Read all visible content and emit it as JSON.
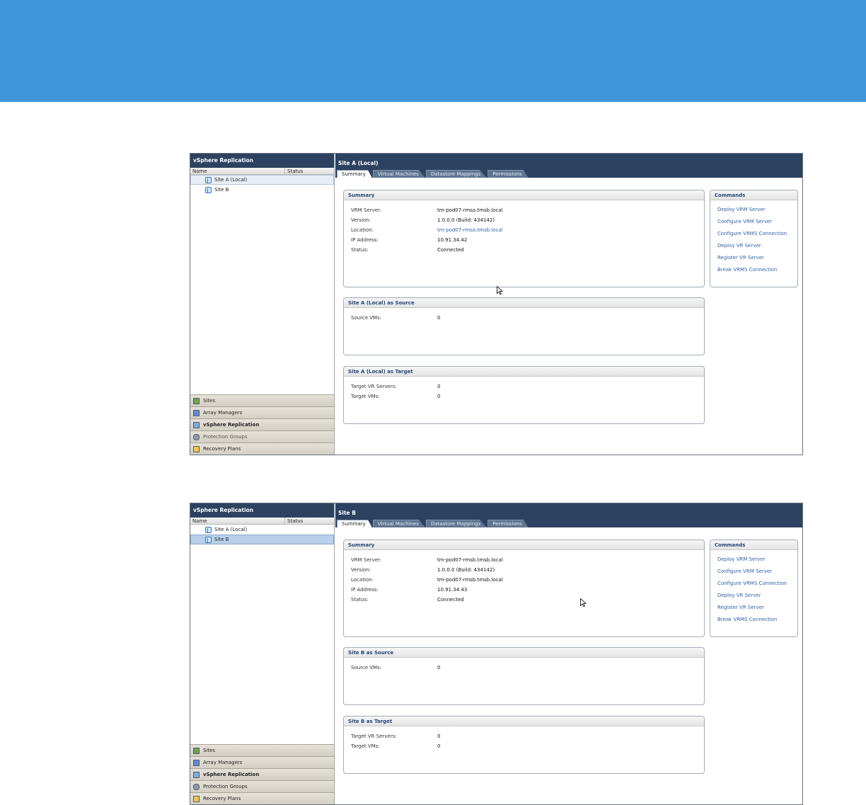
{
  "panes": [
    {
      "left_title": "vSphere Replication",
      "col_name": "Name",
      "col_status": "Status",
      "tree": [
        "Site A (Local)",
        "Site B"
      ],
      "selected_index": 0,
      "nav": [
        "Sites",
        "Array Managers",
        "vSphere Replication",
        "Protection Groups",
        "Recovery Plans"
      ],
      "right_title": "Site A (Local)",
      "tabs": [
        "Summary",
        "Virtual Machines",
        "Datastore Mappings",
        "Permissions"
      ],
      "summary": {
        "title": "Summary",
        "rows": [
          {
            "k": "VRM Server:",
            "v": "tm-pod07-rmsa.tmsb.local"
          },
          {
            "k": "Version:",
            "v": "1.0.0.0 (Build: 434142)"
          },
          {
            "k": "Location:",
            "v": "tm-pod07-rmsa.tmsb.local"
          },
          {
            "k": "IP Address:",
            "v": "10.91.34.42"
          },
          {
            "k": "Status:",
            "v": "Connected"
          }
        ]
      },
      "commands": {
        "title": "Commands",
        "items": [
          "Deploy VRM Server",
          "Configure VRM Server",
          "Configure VRMS Connection",
          "Deploy VR Server",
          "Register VR Server",
          "Break VRMS Connection"
        ]
      },
      "source": {
        "title": "Site A (Local) as Source",
        "rows": [
          {
            "k": "Source VMs:",
            "v": "0"
          }
        ]
      },
      "target": {
        "title": "Site A (Local) as Target",
        "rows": [
          {
            "k": "Target VR Servers:",
            "v": "0"
          },
          {
            "k": "Target VMs:",
            "v": "0"
          }
        ]
      }
    },
    {
      "left_title": "vSphere Replication",
      "col_name": "Name",
      "col_status": "Status",
      "tree": [
        "Site A (Local)",
        "Site B"
      ],
      "selected_index": 1,
      "nav": [
        "Sites",
        "Array Managers",
        "vSphere Replication",
        "Protection Groups",
        "Recovery Plans"
      ],
      "right_title": "Site B",
      "tabs": [
        "Summary",
        "Virtual Machines",
        "Datastore Mappings",
        "Permissions"
      ],
      "summary": {
        "title": "Summary",
        "rows": [
          {
            "k": "VRM Server:",
            "v": "tm-pod07-rmsb.tmsb.local"
          },
          {
            "k": "Version:",
            "v": "1.0.0.0 (Build: 434142)"
          },
          {
            "k": "Location:",
            "v": "tm-pod07-rmsb.tmsb.local"
          },
          {
            "k": "IP Address:",
            "v": "10.91.34.43"
          },
          {
            "k": "Status:",
            "v": "Connected"
          }
        ]
      },
      "commands": {
        "title": "Commands",
        "items": [
          "Deploy VRM Server",
          "Configure VRM Server",
          "Configure VRMS Connection",
          "Deploy VR Server",
          "Register VR Server",
          "Break VRMS Connection"
        ]
      },
      "source": {
        "title": "Site B as Source",
        "rows": [
          {
            "k": "Source VMs:",
            "v": "0"
          }
        ]
      },
      "target": {
        "title": "Site B as Target",
        "rows": [
          {
            "k": "Target VR Servers:",
            "v": "0"
          },
          {
            "k": "Target VMs:",
            "v": "0"
          }
        ]
      }
    }
  ]
}
